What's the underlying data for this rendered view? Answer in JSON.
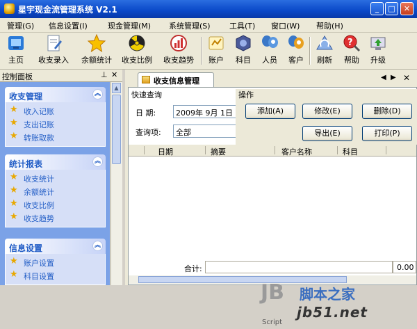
{
  "window": {
    "title": "星宇现金流管理系统 V2.1",
    "controls": [
      "_",
      "□",
      "✕"
    ]
  },
  "menu": [
    "管理(G)",
    "信息设置(I)",
    "现金管理(M)",
    "系统管理(S)",
    "工具(T)",
    "窗口(W)",
    "帮助(H)"
  ],
  "toolbar": [
    {
      "label": "主页",
      "icon": "home-icon"
    },
    {
      "label": "收支录入",
      "icon": "entry-icon"
    },
    {
      "label": "余额统计",
      "icon": "star-icon"
    },
    {
      "label": "收支比例",
      "icon": "pie-icon"
    },
    {
      "label": "收支趋势",
      "icon": "trend-icon"
    },
    {
      "label": "账户",
      "icon": "account-icon"
    },
    {
      "label": "科目",
      "icon": "subject-icon"
    },
    {
      "label": "人员",
      "icon": "people-icon"
    },
    {
      "label": "客户",
      "icon": "customer-icon"
    },
    {
      "label": "刷新",
      "icon": "refresh-icon"
    },
    {
      "label": "帮助",
      "icon": "help-icon"
    },
    {
      "label": "升级",
      "icon": "upgrade-icon"
    }
  ],
  "left_panel": {
    "title": "控制面板",
    "pin": "⊥",
    "close": "✕",
    "groups": [
      {
        "title": "收支管理",
        "items": [
          "收入记账",
          "支出记账",
          "转账取款"
        ]
      },
      {
        "title": "统计报表",
        "items": [
          "收支统计",
          "余额统计",
          "收支比例",
          "收支趋势"
        ]
      },
      {
        "title": "信息设置",
        "items": [
          "账户设置",
          "科目设置"
        ]
      }
    ]
  },
  "tab": {
    "label": "收支信息管理",
    "close": "✕",
    "nav": [
      "◀",
      "▶"
    ]
  },
  "query": {
    "title": "快速查询",
    "date_label": "日  期:",
    "date_value": "2009年 9月 1日",
    "item_label": "查询项:",
    "item_value": "全部"
  },
  "operations": {
    "title": "操作",
    "add": "添加(A)",
    "edit": "修改(E)",
    "delete": "删除(D)",
    "export": "导出(E)",
    "print": "打印(P)"
  },
  "grid": {
    "columns": [
      "日期",
      "摘要",
      "客户名称",
      "科目"
    ],
    "footer_label": "合计:",
    "footer_value": "0.00"
  },
  "watermark": {
    "logo": "JB",
    "script": "Script",
    "site_cn": "脚本之家",
    "site_url": "jb51.net"
  }
}
